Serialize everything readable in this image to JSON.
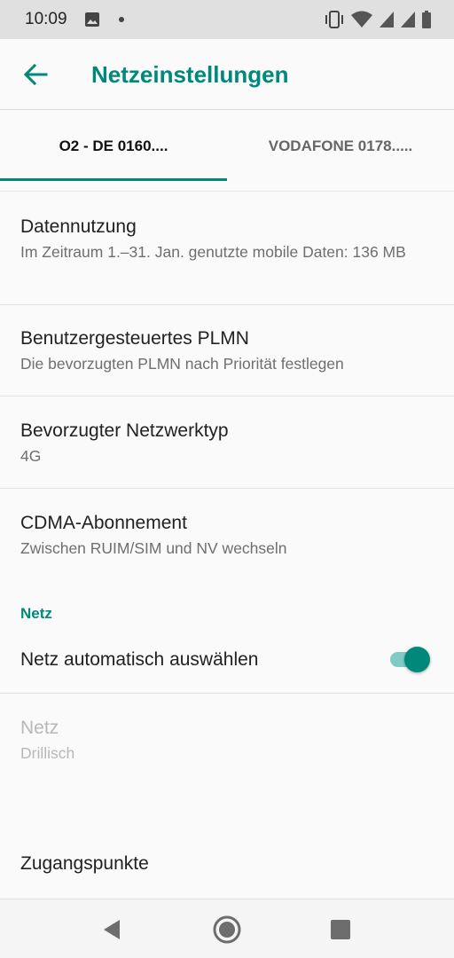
{
  "status_bar": {
    "time": "10:09",
    "left_icons": [
      "image-icon",
      "dot-icon"
    ],
    "right_icons": [
      "vibrate-icon",
      "wifi-icon",
      "signal-icon",
      "signal-icon",
      "battery-icon"
    ]
  },
  "app_bar": {
    "title": "Netzeinstellungen",
    "back_icon": "arrow-back-icon"
  },
  "tabs": [
    {
      "label": "O2 - DE 0160....",
      "selected": true
    },
    {
      "label": "VODAFONE 0178.....",
      "selected": false
    }
  ],
  "preferences": [
    {
      "title": "Datennutzung",
      "summary": "Im Zeitraum 1.–31. Jan. genutzte mobile Daten: 136 MB"
    },
    {
      "title": "Benutzergesteuertes PLMN",
      "summary": "Die bevorzugten PLMN nach Priorität festlegen"
    },
    {
      "title": "Bevorzugter Netzwerktyp",
      "summary": "4G"
    },
    {
      "title": "CDMA-Abonnement",
      "summary": "Zwischen RUIM/SIM und NV wechseln"
    }
  ],
  "network_section": {
    "category": "Netz",
    "auto_select": {
      "title": "Netz automatisch auswählen",
      "enabled": true
    },
    "network": {
      "title": "Netz",
      "summary": "Drillisch",
      "disabled": true
    },
    "access_points": {
      "title": "Zugangspunkte"
    }
  },
  "accent_color": "#00897b",
  "nav_bar": {
    "buttons": [
      "back-triangle-icon",
      "home-circle-icon",
      "recents-square-icon"
    ]
  }
}
